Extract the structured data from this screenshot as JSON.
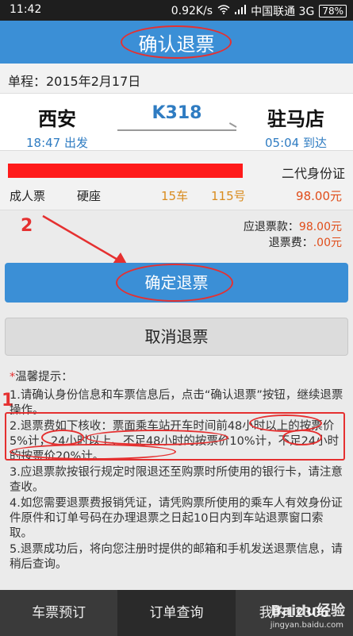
{
  "status_bar": {
    "time": "11:42",
    "speed": "0.92K/s",
    "carrier": "中国联通 3G",
    "battery": "78%"
  },
  "header": {
    "title": "确认退票"
  },
  "trip": {
    "date_label": "单程：2015年2月17日"
  },
  "train": {
    "from_station": "西安",
    "from_time": "18:47 出发",
    "number": "K318",
    "to_station": "驻马店",
    "to_time": "05:04 到达"
  },
  "passenger": {
    "id_type": "二代身份证",
    "ticket_type": "成人票",
    "seat_class": "硬座",
    "car": "15车",
    "seat_no": "115号",
    "price": "98.00元"
  },
  "refund": {
    "amount_label": "应退票款：",
    "amount_value": "98.00元",
    "fee_label": "退票费：",
    "fee_value": ".00元"
  },
  "buttons": {
    "confirm": "确定退票",
    "cancel": "取消退票"
  },
  "tips": {
    "star": "*",
    "title": "温馨提示：",
    "items": [
      "1.请确认身份信息和车票信息后，点击“确认退票”按钮，继续退票操作。",
      "2.退票费如下核收：票面乘车站开车时间前48小时以上的按票价5%计，24小时以上、不足48小时的按票价10%计，不足24小时的按票价20%计。",
      "3.应退票款按银行规定时限退还至购票时所使用的银行卡，请注意查收。",
      "4.如您需要退票费报销凭证，请凭购票所使用的乘车人有效身份证件原件和订单号码在办理退票之日起10日内到车站退票窗口索取。",
      "5.退票成功后，将向您注册时提供的邮箱和手机发送退票信息，请稍后查询。"
    ]
  },
  "annotations": {
    "mark_1": "1",
    "mark_2": "2"
  },
  "nav": {
    "items": [
      "车票预订",
      "订单查询",
      "我的12306"
    ]
  },
  "watermark": {
    "text": "Baidu经验",
    "url": "jingyan.baidu.com"
  },
  "colors": {
    "accent": "#3b8fd6",
    "annotation": "#e53030",
    "price": "#e04d1a"
  }
}
